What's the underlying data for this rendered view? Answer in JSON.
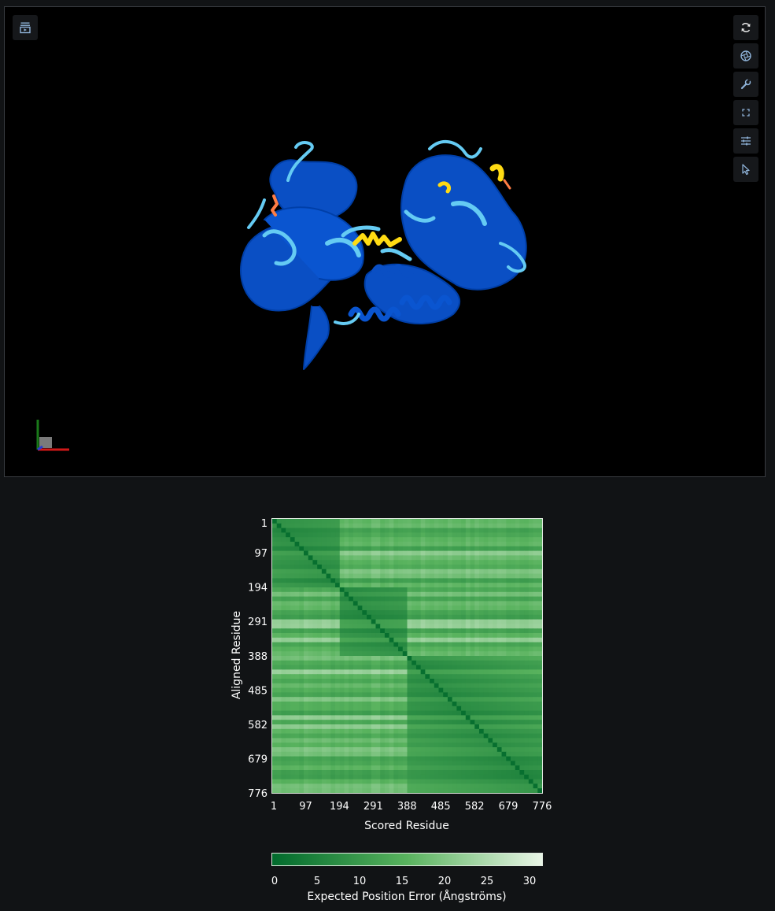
{
  "viewer": {
    "toolbar_left": [
      {
        "icon": "animation-icon"
      }
    ],
    "toolbar_right": [
      {
        "icon": "reset-view-icon"
      },
      {
        "icon": "snapshot-icon"
      },
      {
        "icon": "settings-wrench-icon"
      },
      {
        "icon": "fullscreen-icon"
      },
      {
        "icon": "controls-sliders-icon"
      },
      {
        "icon": "select-cursor-icon"
      }
    ],
    "structure_colors": {
      "very_high": "#0053d6",
      "confident": "#65cbf3",
      "low": "#ffdb13",
      "very_low": "#ff7d45"
    }
  },
  "pae": {
    "y_axis_title": "Aligned Residue",
    "x_axis_title": "Scored Residue",
    "y_ticks": [
      "1",
      "97",
      "194",
      "291",
      "388",
      "485",
      "582",
      "679",
      "776"
    ],
    "x_ticks": [
      "1",
      "97",
      "194",
      "291",
      "388",
      "485",
      "582",
      "679",
      "776"
    ],
    "colorbar": {
      "title": "Expected Position Error (Ångströms)",
      "ticks": [
        "0",
        "5",
        "10",
        "15",
        "20",
        "25",
        "30"
      ],
      "min": 0,
      "max": 30,
      "color_low": "#016a2c",
      "color_high": "#e9f5e6"
    }
  },
  "chart_data": {
    "type": "heatmap",
    "xlabel": "Scored Residue",
    "ylabel": "Aligned Residue",
    "x_ticks": [
      1,
      97,
      194,
      291,
      388,
      485,
      582,
      679,
      776
    ],
    "y_ticks": [
      1,
      97,
      194,
      291,
      388,
      485,
      582,
      679,
      776
    ],
    "xlim": [
      1,
      776
    ],
    "ylim": [
      1,
      776
    ],
    "domains": [
      [
        1,
        194
      ],
      [
        194,
        388
      ],
      [
        388,
        776
      ]
    ],
    "colorbar_label": "Expected Position Error (Ångströms)",
    "color_range": [
      0,
      30
    ]
  }
}
